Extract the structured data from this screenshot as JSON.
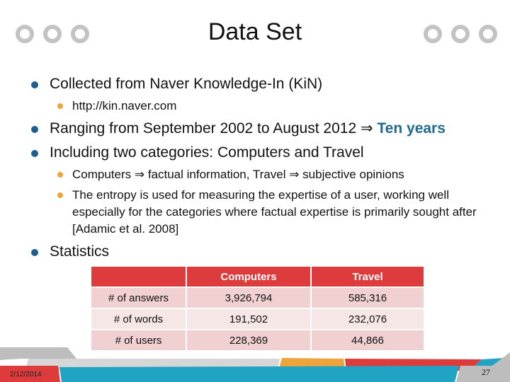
{
  "slide": {
    "title": "Data Set",
    "decoration": {
      "left_circles": "three-circles-icon",
      "right_circles": "three-circles-icon"
    },
    "bullets": [
      {
        "text": "Collected from Naver Knowledge-In (KiN)",
        "sub": [
          {
            "text": "http://kin.naver.com"
          }
        ]
      },
      {
        "text_before": "Ranging from September 2002 to August 2012 ",
        "arrow": "⇒",
        "highlight": " Ten years"
      },
      {
        "text": "Including two categories: Computers and Travel",
        "sub": [
          {
            "text": "Computers ⇒ factual information, Travel ⇒ subjective opinions"
          },
          {
            "text": "The entropy is used for measuring the expertise of a user, working well especially for the categories where factual expertise is primarily sought after [Adamic et al. 2008]"
          }
        ]
      },
      {
        "text": "Statistics"
      }
    ],
    "table": {
      "headers": [
        "",
        "Computers",
        "Travel"
      ],
      "rows": [
        [
          "# of answers",
          "3,926,794",
          "585,316"
        ],
        [
          "# of words",
          "191,502",
          "232,076"
        ],
        [
          "# of users",
          "228,369",
          "44,866"
        ]
      ]
    },
    "footer": {
      "date": "2/12/2014",
      "page_number": "27"
    },
    "colors": {
      "accent_red": "#de3b3c",
      "accent_teal": "#21a3c4",
      "accent_orange": "#eea43a",
      "bullet_blue": "#1c5f8f",
      "highlight": "#1f6a8f"
    }
  }
}
